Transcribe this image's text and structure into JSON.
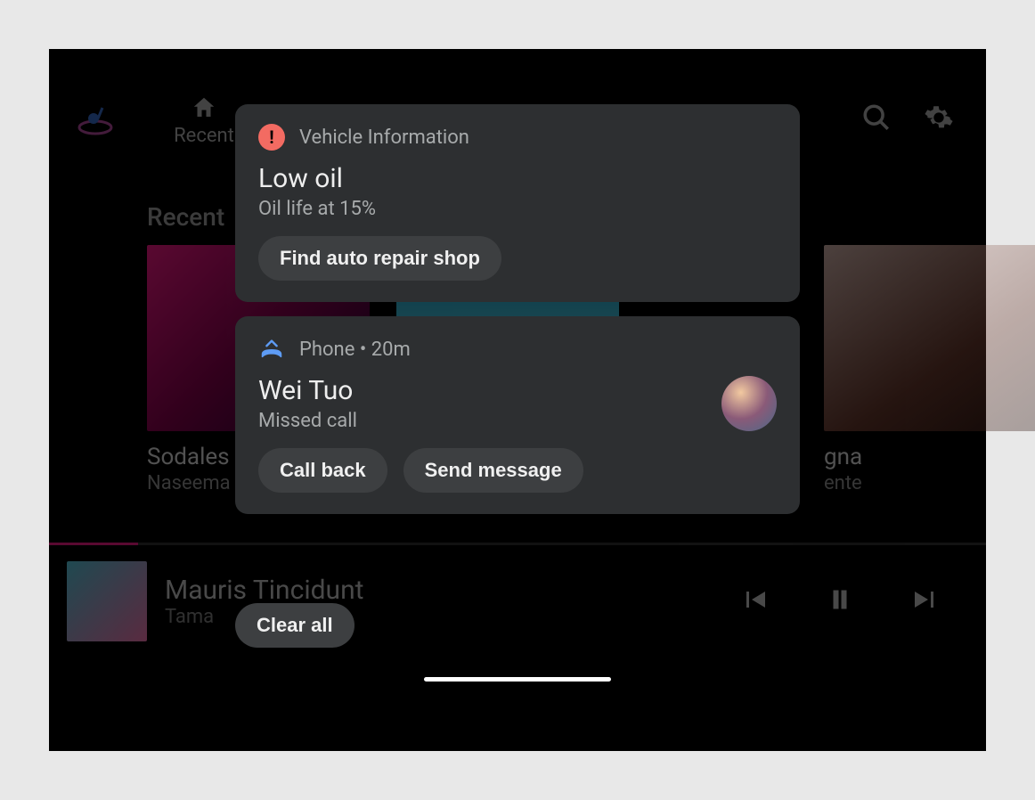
{
  "topbar": {
    "tabs": [
      {
        "id": "recent",
        "label": "Recent"
      }
    ],
    "search_label": "Search",
    "settings_label": "Settings"
  },
  "section": {
    "title": "Recent"
  },
  "albums": [
    {
      "title": "Sodales",
      "subtitle": "Naseema"
    },
    {
      "title": "",
      "subtitle": ""
    },
    {
      "title": "gna",
      "subtitle": "ente"
    }
  ],
  "nowplaying": {
    "title": "Mauris Tincidunt",
    "subtitle": "Tama"
  },
  "notifications": [
    {
      "app": "Vehicle Information",
      "title": "Low oil",
      "subtitle": "Oil life at 15%",
      "actions": [
        "Find auto repair shop"
      ]
    },
    {
      "app": "Phone",
      "time": "20m",
      "title": "Wei Tuo",
      "subtitle": "Missed call",
      "actions": [
        "Call back",
        "Send message"
      ]
    }
  ],
  "clear_all_label": "Clear all"
}
